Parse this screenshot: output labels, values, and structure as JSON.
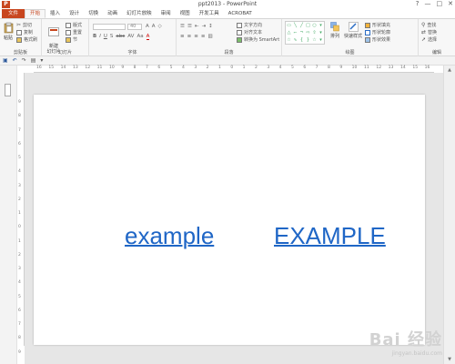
{
  "window": {
    "title": "ppt2013 - PowerPoint",
    "app_icon_letter": "P",
    "controls": [
      "?",
      "—",
      "□",
      "✕"
    ]
  },
  "tabs": [
    "文件",
    "开始",
    "插入",
    "设计",
    "切换",
    "动画",
    "幻灯片放映",
    "审阅",
    "视图",
    "开发工具",
    "ACROBAT"
  ],
  "active_tab": "开始",
  "ribbon": {
    "clipboard": {
      "paste": "粘贴",
      "cut": "剪切",
      "copy": "复制",
      "format_painter": "格式刷",
      "label": "剪贴板"
    },
    "slides": {
      "new_slide": "新建\n幻灯片",
      "layout": "版式",
      "reset": "重置",
      "section": "节",
      "label": "幻灯片"
    },
    "font": {
      "label": "字体",
      "size_placeholder": "40",
      "format_buttons": [
        "B",
        "I",
        "U",
        "S",
        "abc",
        "AV",
        "Aa",
        "A"
      ]
    },
    "paragraph": {
      "label": "段落",
      "text_direction": "文字方向",
      "align_text": "对齐文本",
      "smartart": "转换为 SmartArt"
    },
    "drawing": {
      "label": "绘图",
      "arrange": "排列",
      "quick_styles": "快速样式",
      "shape_fill": "形状填充",
      "shape_outline": "形状轮廓",
      "shape_effects": "形状效果"
    },
    "editing": {
      "label": "编辑",
      "find": "查找",
      "replace": "替换",
      "select": "选择"
    }
  },
  "ruler": {
    "horizontal": [
      "16",
      "15",
      "14",
      "13",
      "12",
      "11",
      "10",
      "9",
      "8",
      "7",
      "6",
      "5",
      "4",
      "3",
      "2",
      "1",
      "0",
      "1",
      "2",
      "3",
      "4",
      "5",
      "6",
      "7",
      "8",
      "9",
      "10",
      "11",
      "12",
      "13",
      "14",
      "15",
      "16"
    ],
    "vertical": [
      "9",
      "8",
      "7",
      "6",
      "5",
      "4",
      "3",
      "2",
      "1",
      "0",
      "1",
      "2",
      "3",
      "4",
      "5",
      "6",
      "7",
      "8",
      "9"
    ]
  },
  "slide": {
    "link_lower": "example",
    "link_upper": "EXAMPLE",
    "link_color": "#1f66c6"
  },
  "watermark": {
    "logo": "Bai 经验",
    "url": "jingyan.baidu.com"
  },
  "colors": {
    "accent": "#c8461f",
    "hyperlink": "#1f66c6"
  }
}
